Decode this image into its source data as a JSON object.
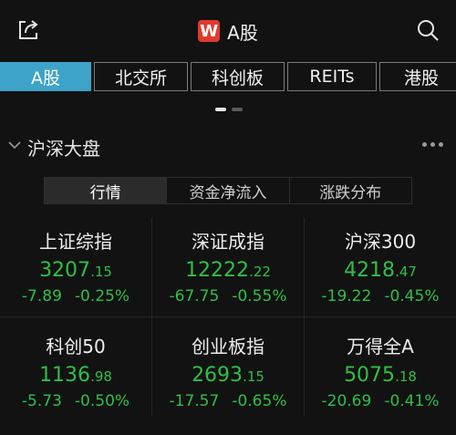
{
  "header": {
    "title": "A股",
    "logo_letter": "W",
    "logo_color": "#e03a2f"
  },
  "tabs": [
    {
      "label": "A股",
      "active": true
    },
    {
      "label": "北交所"
    },
    {
      "label": "科创板"
    },
    {
      "label": "REITs"
    },
    {
      "label": "港股"
    }
  ],
  "section": {
    "title": "沪深大盘",
    "segments": [
      {
        "label": "行情",
        "active": true
      },
      {
        "label": "资金净流入"
      },
      {
        "label": "涨跌分布"
      }
    ]
  },
  "indices": [
    {
      "name": "上证综指",
      "value_int": "3207",
      "value_dec": ".15",
      "change": "-7.89",
      "pct": "-0.25%"
    },
    {
      "name": "深证成指",
      "value_int": "12222",
      "value_dec": ".22",
      "change": "-67.75",
      "pct": "-0.55%"
    },
    {
      "name": "沪深300",
      "value_int": "4218",
      "value_dec": ".47",
      "change": "-19.22",
      "pct": "-0.45%"
    },
    {
      "name": "科创50",
      "value_int": "1136",
      "value_dec": ".98",
      "change": "-5.73",
      "pct": "-0.50%"
    },
    {
      "name": "创业板指",
      "value_int": "2693",
      "value_dec": ".15",
      "change": "-17.57",
      "pct": "-0.65%"
    },
    {
      "name": "万得全A",
      "value_int": "5075",
      "value_dec": ".18",
      "change": "-20.69",
      "pct": "-0.41%"
    }
  ],
  "colors": {
    "down": "#2fbf47",
    "accent": "#3ea3c8",
    "background": "#121212"
  }
}
